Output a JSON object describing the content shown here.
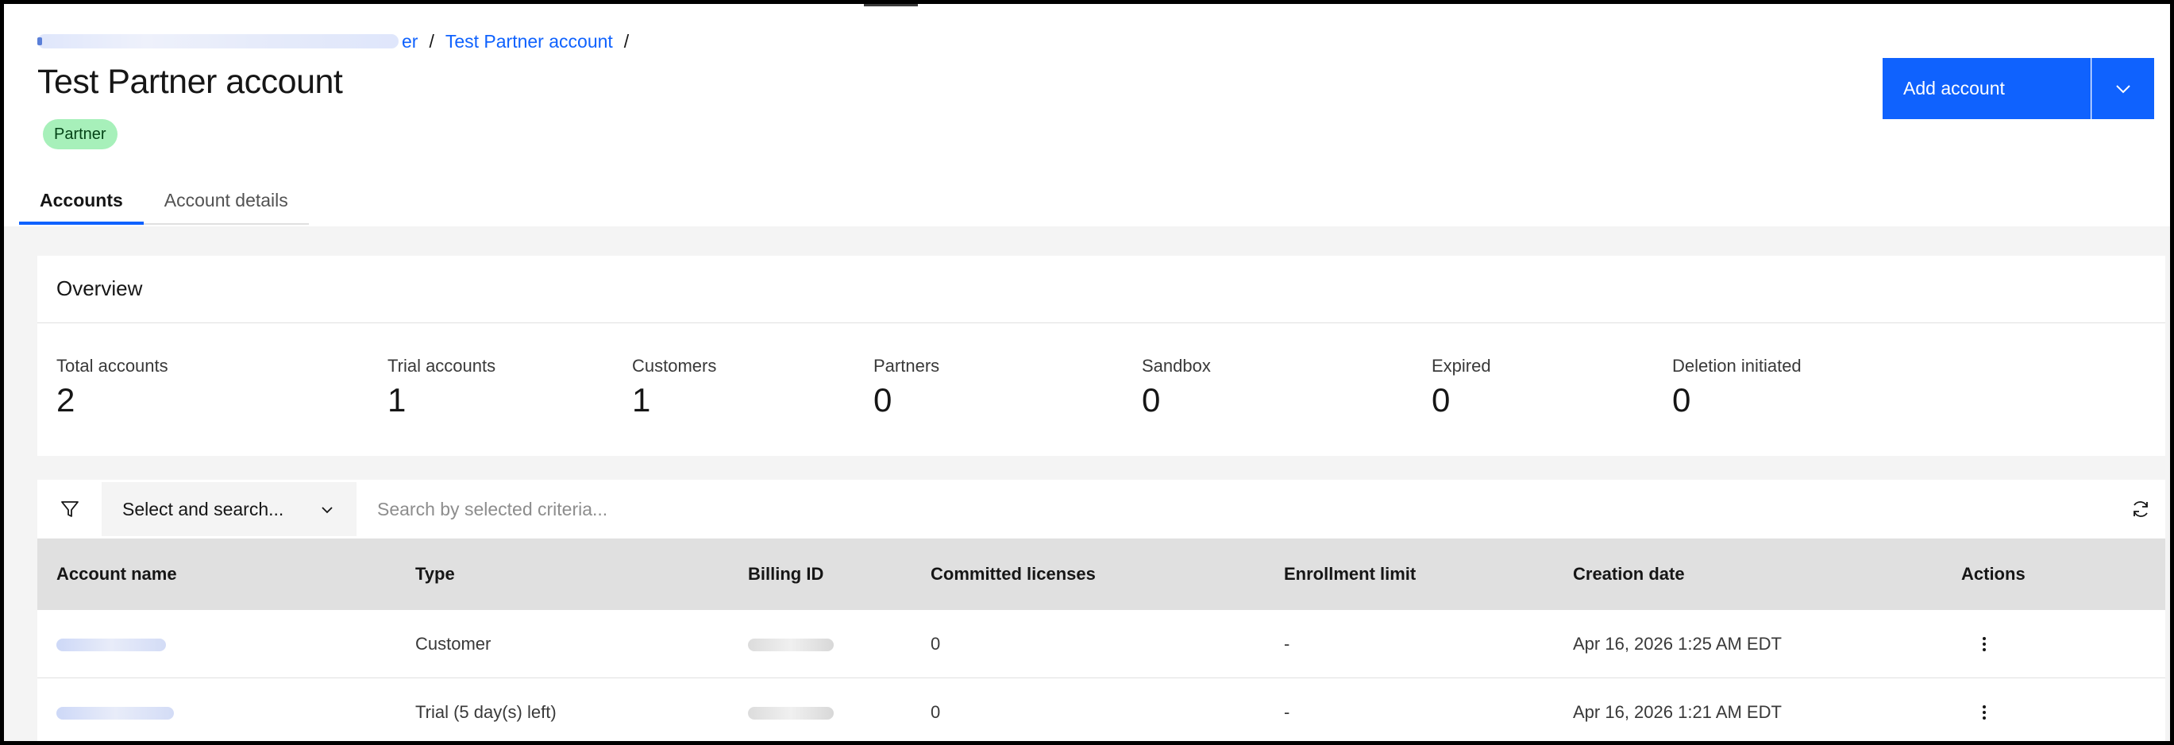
{
  "breadcrumb": {
    "truncated_tail": "er",
    "separator": "/",
    "current": "Test Partner account"
  },
  "page": {
    "title": "Test Partner account",
    "tag": "Partner"
  },
  "actions": {
    "add_account": "Add account"
  },
  "tabs": [
    {
      "label": "Accounts",
      "active": true
    },
    {
      "label": "Account details",
      "active": false
    }
  ],
  "overview": {
    "title": "Overview",
    "stats": [
      {
        "label": "Total accounts",
        "value": "2"
      },
      {
        "label": "Trial accounts",
        "value": "1"
      },
      {
        "label": "Customers",
        "value": "1"
      },
      {
        "label": "Partners",
        "value": "0"
      },
      {
        "label": "Sandbox",
        "value": "0"
      },
      {
        "label": "Expired",
        "value": "0"
      },
      {
        "label": "Deletion initiated",
        "value": "0"
      }
    ]
  },
  "toolbar": {
    "select_label": "Select and search...",
    "search_placeholder": "Search by selected criteria..."
  },
  "table": {
    "columns": [
      "Account name",
      "Type",
      "Billing ID",
      "Committed licenses",
      "Enrollment limit",
      "Creation date",
      "Actions"
    ],
    "rows": [
      {
        "type": "Customer",
        "committed": "0",
        "enrollment": "-",
        "created": "Apr 16, 2026 1:25 AM EDT"
      },
      {
        "type": "Trial (5 day(s) left)",
        "committed": "0",
        "enrollment": "-",
        "created": "Apr 16, 2026 1:21 AM EDT"
      }
    ]
  },
  "colors": {
    "primary": "#0f62fe",
    "tag_bg": "#a7f0ba",
    "tag_text": "#044317",
    "header_bg": "#e0e0e0",
    "page_bg": "#f4f4f4"
  },
  "icons": {
    "filter": "filter-icon",
    "chevron": "chevron-down-icon",
    "refresh": "refresh-icon",
    "overflow": "overflow-menu-icon"
  }
}
